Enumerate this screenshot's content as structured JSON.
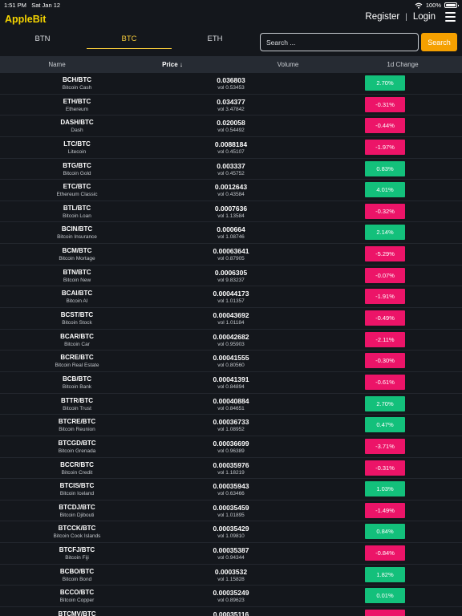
{
  "status_bar": {
    "time": "1:51 PM",
    "date": "Sat Jan 12",
    "battery": "100%"
  },
  "header": {
    "brand": "AppleBit",
    "register": "Register",
    "login": "Login"
  },
  "tabs": [
    {
      "label": "BTN"
    },
    {
      "label": "BTC"
    },
    {
      "label": "ETH"
    }
  ],
  "active_tab": "BTC",
  "search": {
    "placeholder": "Search ...",
    "value": "",
    "button": "Search"
  },
  "table": {
    "columns": {
      "name": "Name",
      "price": "Price ↓",
      "volume": "Volume",
      "change": "1d Change"
    },
    "rows": [
      {
        "pair": "BCH/BTC",
        "name": "Bitcoin Cash",
        "price": "0.036803",
        "vol": "vol 0.53453",
        "change": "2.70%",
        "dir": "up"
      },
      {
        "pair": "ETH/BTC",
        "name": "Ethereum",
        "price": "0.034377",
        "vol": "vol 3.47842",
        "change": "-0.31%",
        "dir": "down"
      },
      {
        "pair": "DASH/BTC",
        "name": "Dash",
        "price": "0.020058",
        "vol": "vol 0.54492",
        "change": "-0.44%",
        "dir": "down"
      },
      {
        "pair": "LTC/BTC",
        "name": "Litecoin",
        "price": "0.0088184",
        "vol": "vol 0.45107",
        "change": "-1.97%",
        "dir": "down"
      },
      {
        "pair": "BTG/BTC",
        "name": "Bitcoin Gold",
        "price": "0.003337",
        "vol": "vol 0.45752",
        "change": "0.83%",
        "dir": "up"
      },
      {
        "pair": "ETC/BTC",
        "name": "Ethereum Classic",
        "price": "0.0012643",
        "vol": "vol 0.43584",
        "change": "4.01%",
        "dir": "up"
      },
      {
        "pair": "BTL/BTC",
        "name": "Bitcoin Loan",
        "price": "0.0007636",
        "vol": "vol 1.13584",
        "change": "-0.32%",
        "dir": "down"
      },
      {
        "pair": "BCIN/BTC",
        "name": "Bitcoin Insurance",
        "price": "0.000664",
        "vol": "vol 1.08746",
        "change": "2.14%",
        "dir": "up"
      },
      {
        "pair": "BCM/BTC",
        "name": "Bitcoin Mortage",
        "price": "0.00063641",
        "vol": "vol 0.87905",
        "change": "-5.29%",
        "dir": "down"
      },
      {
        "pair": "BTN/BTC",
        "name": "Bitcoin New",
        "price": "0.0006305",
        "vol": "vol 9.83237",
        "change": "-0.07%",
        "dir": "down"
      },
      {
        "pair": "BCAI/BTC",
        "name": "Bitcoin AI",
        "price": "0.00044173",
        "vol": "vol 1.01357",
        "change": "-1.91%",
        "dir": "down"
      },
      {
        "pair": "BCST/BTC",
        "name": "Bitcoin Stock",
        "price": "0.00043692",
        "vol": "vol 1.01184",
        "change": "-0.49%",
        "dir": "down"
      },
      {
        "pair": "BCAR/BTC",
        "name": "Bitcoin Car",
        "price": "0.00042682",
        "vol": "vol 0.95903",
        "change": "-2.11%",
        "dir": "down"
      },
      {
        "pair": "BCRE/BTC",
        "name": "Bitcoin Real Estate",
        "price": "0.00041555",
        "vol": "vol 0.80560",
        "change": "-0.30%",
        "dir": "down"
      },
      {
        "pair": "BCB/BTC",
        "name": "Bitcoin Bank",
        "price": "0.00041391",
        "vol": "vol 0.84894",
        "change": "-0.61%",
        "dir": "down"
      },
      {
        "pair": "BTTR/BTC",
        "name": "Bitcoin Trust",
        "price": "0.00040884",
        "vol": "vol 0.84651",
        "change": "2.70%",
        "dir": "up"
      },
      {
        "pair": "BTCRE/BTC",
        "name": "Bitcoin Reunion",
        "price": "0.00036733",
        "vol": "vol 1.08952",
        "change": "0.47%",
        "dir": "up"
      },
      {
        "pair": "BTCGD/BTC",
        "name": "Bitcoin Grenada",
        "price": "0.00036699",
        "vol": "vol 0.96389",
        "change": "-3.71%",
        "dir": "down"
      },
      {
        "pair": "BCCR/BTC",
        "name": "Bitcoin Credit",
        "price": "0.00035976",
        "vol": "vol 1.18219",
        "change": "-0.31%",
        "dir": "down"
      },
      {
        "pair": "BTCIS/BTC",
        "name": "Bitcoin Iceland",
        "price": "0.00035943",
        "vol": "vol 0.63466",
        "change": "1.03%",
        "dir": "up"
      },
      {
        "pair": "BTCDJ/BTC",
        "name": "Bitcoin Djibouti",
        "price": "0.00035459",
        "vol": "vol 1.01895",
        "change": "-1.49%",
        "dir": "down"
      },
      {
        "pair": "BTCCK/BTC",
        "name": "Bitcoin Cook Islands",
        "price": "0.00035429",
        "vol": "vol 1.09810",
        "change": "0.84%",
        "dir": "up"
      },
      {
        "pair": "BTCFJ/BTC",
        "name": "Bitcoin Fiji",
        "price": "0.00035387",
        "vol": "vol 0.94344",
        "change": "-0.84%",
        "dir": "down"
      },
      {
        "pair": "BCBO/BTC",
        "name": "Bitcoin Bond",
        "price": "0.0003532",
        "vol": "vol 1.15828",
        "change": "1.82%",
        "dir": "up"
      },
      {
        "pair": "BCCO/BTC",
        "name": "Bitcoin Copper",
        "price": "0.00035249",
        "vol": "vol 0.89623",
        "change": "0.01%",
        "dir": "up"
      },
      {
        "pair": "BTCMV/BTC",
        "name": "",
        "price": "0.00035116",
        "vol": "",
        "change": "",
        "dir": "down"
      }
    ]
  },
  "colors": {
    "brand": "#f5d400",
    "accent": "#f3c93a",
    "search_button": "#f5a000",
    "up": "#13c07b",
    "down": "#ec1468"
  },
  "icons": [
    "wifi-icon",
    "battery-icon",
    "hamburger-menu-icon",
    "sort-down-arrow-icon"
  ]
}
